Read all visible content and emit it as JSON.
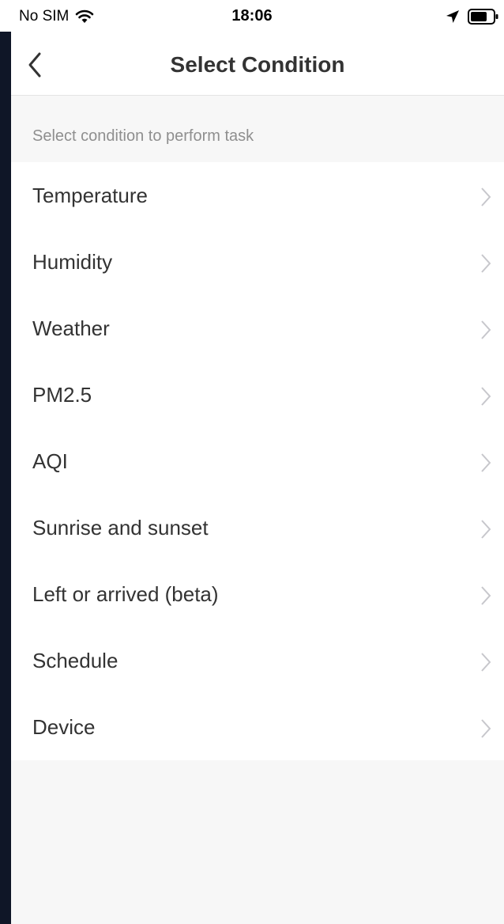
{
  "status_bar": {
    "carrier": "No SIM",
    "time": "18:06"
  },
  "nav": {
    "title": "Select Condition"
  },
  "section": {
    "header": "Select condition to perform task"
  },
  "conditions": [
    {
      "label": "Temperature"
    },
    {
      "label": "Humidity"
    },
    {
      "label": "Weather"
    },
    {
      "label": "PM2.5"
    },
    {
      "label": "AQI"
    },
    {
      "label": "Sunrise and sunset"
    },
    {
      "label": "Left or arrived (beta)"
    },
    {
      "label": "Schedule"
    },
    {
      "label": "Device"
    }
  ],
  "colors": {
    "background": "#f7f7f7",
    "card": "#ffffff",
    "text_primary": "#333333",
    "text_secondary": "#8f8f8f",
    "chevron": "#c7c7cc",
    "frame": "#0f1627"
  }
}
